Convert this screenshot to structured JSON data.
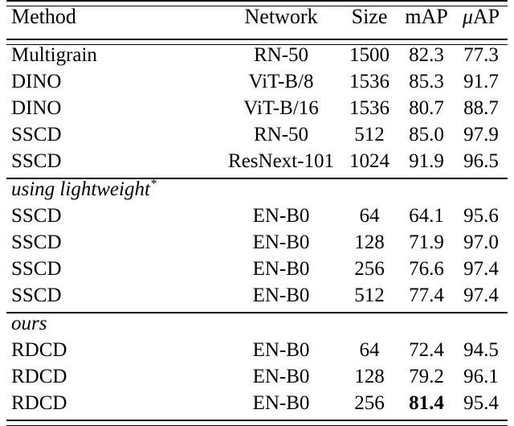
{
  "table": {
    "columns": [
      {
        "key": "method",
        "label": "Method",
        "align": "left"
      },
      {
        "key": "network",
        "label": "Network",
        "align": "center"
      },
      {
        "key": "size",
        "label": "Size",
        "align": "center"
      },
      {
        "key": "map",
        "label": "mAP",
        "align": "center"
      },
      {
        "key": "uap",
        "label": "μAP",
        "align": "center"
      }
    ],
    "header": {
      "method": "Method",
      "network": "Network",
      "size": "Size",
      "map": "mAP",
      "uap_mu": "μ",
      "uap_rest": "AP"
    },
    "sections": [
      {
        "label": null,
        "rows": [
          {
            "method": "Multigrain",
            "network": "RN-50",
            "size": "1500",
            "map": "82.3",
            "uap": "77.3",
            "map_bold": false
          },
          {
            "method": "DINO",
            "network": "ViT-B/8",
            "size": "1536",
            "map": "85.3",
            "uap": "91.7",
            "map_bold": false
          },
          {
            "method": "DINO",
            "network": "ViT-B/16",
            "size": "1536",
            "map": "80.7",
            "uap": "88.7",
            "map_bold": false
          },
          {
            "method": "SSCD",
            "network": "RN-50",
            "size": "512",
            "map": "85.0",
            "uap": "97.9",
            "map_bold": false
          },
          {
            "method": "SSCD",
            "network": "ResNext-101",
            "size": "1024",
            "map": "91.9",
            "uap": "96.5",
            "map_bold": false
          }
        ]
      },
      {
        "label": "using lightweight",
        "label_superscript": "*",
        "rows": [
          {
            "method": "SSCD",
            "network": "EN-B0",
            "size": "64",
            "map": "64.1",
            "uap": "95.6",
            "map_bold": false
          },
          {
            "method": "SSCD",
            "network": "EN-B0",
            "size": "128",
            "map": "71.9",
            "uap": "97.0",
            "map_bold": false
          },
          {
            "method": "SSCD",
            "network": "EN-B0",
            "size": "256",
            "map": "76.6",
            "uap": "97.4",
            "map_bold": false
          },
          {
            "method": "SSCD",
            "network": "EN-B0",
            "size": "512",
            "map": "77.4",
            "uap": "97.4",
            "map_bold": false
          }
        ]
      },
      {
        "label": "ours",
        "label_superscript": "",
        "rows": [
          {
            "method": "RDCD",
            "network": "EN-B0",
            "size": "64",
            "map": "72.4",
            "uap": "94.5",
            "map_bold": false
          },
          {
            "method": "RDCD",
            "network": "EN-B0",
            "size": "128",
            "map": "79.2",
            "uap": "96.1",
            "map_bold": false
          },
          {
            "method": "RDCD",
            "network": "EN-B0",
            "size": "256",
            "map": "81.4",
            "uap": "95.4",
            "map_bold": true
          }
        ]
      }
    ]
  },
  "colors": {
    "text": "#000000",
    "background": "#ffffff",
    "rule": "#000000"
  }
}
